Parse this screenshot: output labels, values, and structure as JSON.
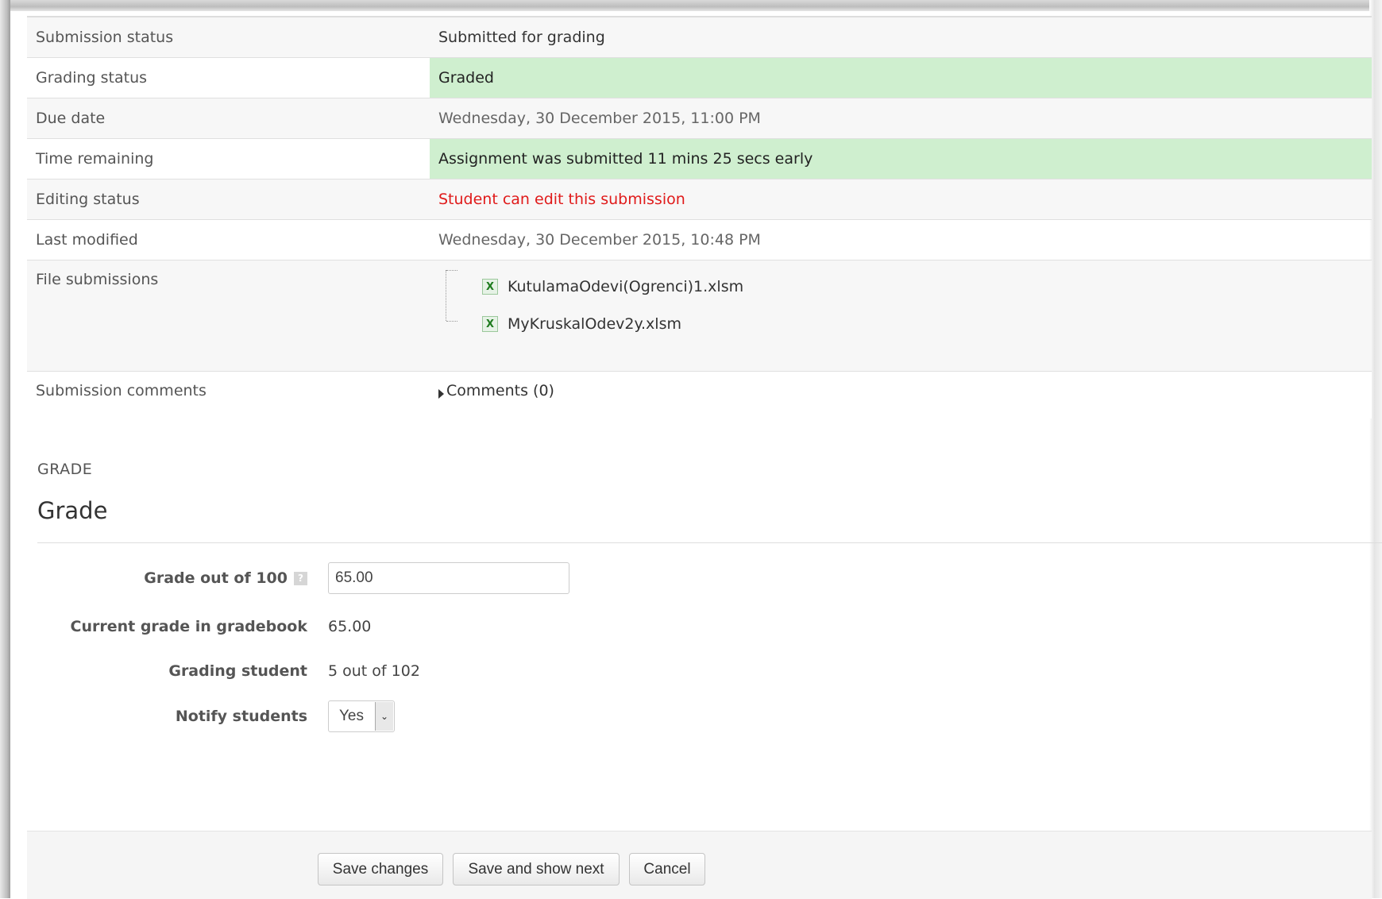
{
  "submission_table": [
    {
      "label": "Submission status",
      "value": "Submitted for grading",
      "style": "plain"
    },
    {
      "label": "Grading status",
      "value": "Graded",
      "style": "green"
    },
    {
      "label": "Due date",
      "value": "Wednesday, 30 December 2015, 11:00 PM",
      "style": "muted"
    },
    {
      "label": "Time remaining",
      "value": "Assignment was submitted 11 mins 25 secs early",
      "style": "green"
    },
    {
      "label": "Editing status",
      "value": "Student can edit this submission",
      "style": "red"
    },
    {
      "label": "Last modified",
      "value": "Wednesday, 30 December 2015, 10:48 PM",
      "style": "muted"
    }
  ],
  "file_submissions": {
    "label": "File submissions",
    "files": [
      "KutulamaOdevi(Ogrenci)1.xlsm",
      "MyKruskalOdev2y.xlsm"
    ],
    "file_icon": "excel-file-icon"
  },
  "submission_comments": {
    "label": "Submission comments",
    "toggle_text": "Comments (0)"
  },
  "grade_section": {
    "caption": "GRADE",
    "heading": "Grade",
    "grade_label": "Grade out of 100",
    "grade_value": "65.00",
    "current_grade_label": "Current grade in gradebook",
    "current_grade_value": "65.00",
    "grading_student_label": "Grading student",
    "grading_student_value": "5 out of 102",
    "notify_label": "Notify students",
    "notify_value": "Yes"
  },
  "actions": {
    "save": "Save changes",
    "save_next": "Save and show next",
    "cancel": "Cancel"
  },
  "colors": {
    "success_bg": "#cfefcf",
    "error_text": "#e01a1a"
  }
}
